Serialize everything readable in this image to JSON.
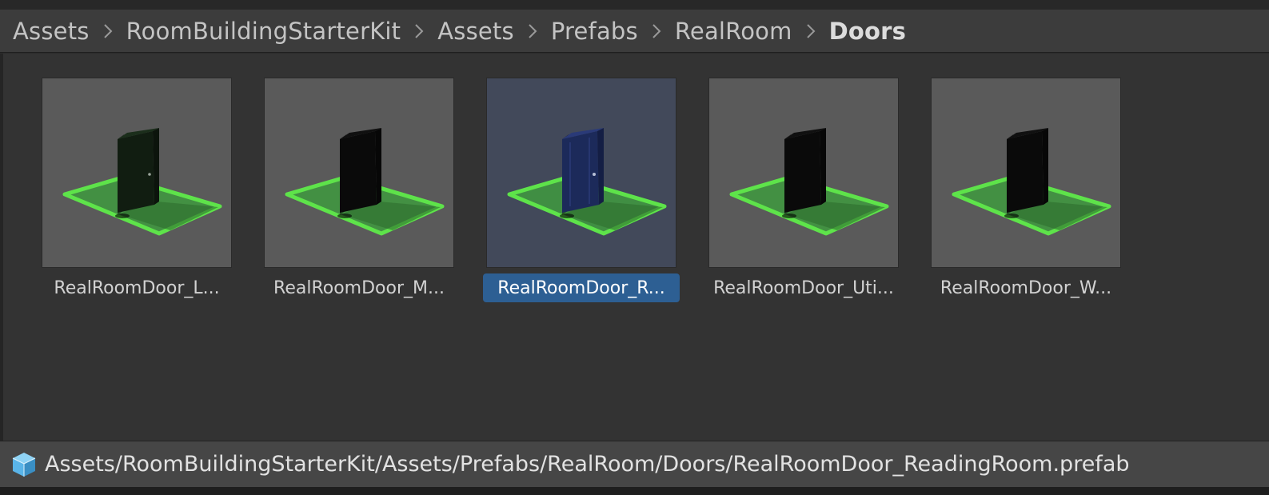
{
  "breadcrumb": {
    "items": [
      "Assets",
      "RoomBuildingStarterKit",
      "Assets",
      "Prefabs",
      "RealRoom",
      "Doors"
    ]
  },
  "assets": {
    "items": [
      {
        "label": "RealRoomDoor_L...",
        "selected": false,
        "door_color": "#111d11"
      },
      {
        "label": "RealRoomDoor_M...",
        "selected": false,
        "door_color": "#0a0a0a"
      },
      {
        "label": "RealRoomDoor_R...",
        "selected": true,
        "door_color": "#1c2a5a"
      },
      {
        "label": "RealRoomDoor_Uti...",
        "selected": false,
        "door_color": "#0a0a0a"
      },
      {
        "label": "RealRoomDoor_W...",
        "selected": false,
        "door_color": "#0a0a0a"
      }
    ]
  },
  "status": {
    "icon": "prefab-cube-icon",
    "path": "Assets/RoomBuildingStarterKit/Assets/Prefabs/RealRoom/Doors/RealRoomDoor_ReadingRoom.prefab"
  },
  "colors": {
    "selection": "#2d5f93",
    "floor_green": "#5ee34a",
    "prefab_icon": "#5ab4e8"
  }
}
